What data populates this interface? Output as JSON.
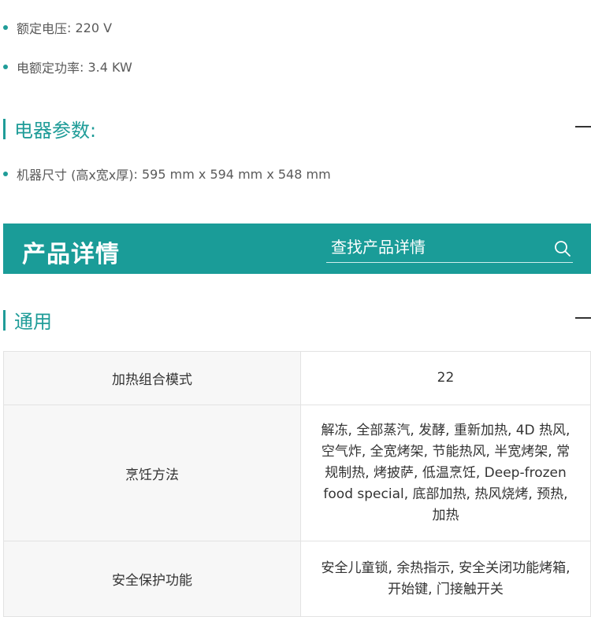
{
  "specs_top": [
    {
      "label": "额定电压",
      "value": "220 V"
    },
    {
      "label": "电额定功率",
      "value": "3.4 KW"
    }
  ],
  "sections": {
    "electrical": {
      "title": "电器参数:"
    },
    "general": {
      "title": "通用"
    }
  },
  "electrical_items": [
    {
      "label": "机器尺寸 (高x宽x厚)",
      "value": "595 mm x 594 mm x 548 mm"
    }
  ],
  "banner": {
    "title": "产品详情",
    "search_placeholder": "查找产品详情"
  },
  "table": {
    "rows": [
      {
        "label": "加热组合模式",
        "value": "22"
      },
      {
        "label": "烹饪方法",
        "value": "解冻, 全部蒸汽, 发酵, 重新加热, 4D 热风, 空气炸, 全宽烤架, 节能热风, 半宽烤架, 常规制热, 烤披萨, 低温烹饪, Deep-frozen food special, 底部加热, 热风烧烤, 预热, 加热"
      },
      {
        "label": "安全保护功能",
        "value": "安全儿童锁, 余热指示, 安全关闭功能烤箱, 开始键, 门接触开关"
      }
    ]
  },
  "colors": {
    "accent": "#1f9c98",
    "banner": "#1a9c98"
  }
}
